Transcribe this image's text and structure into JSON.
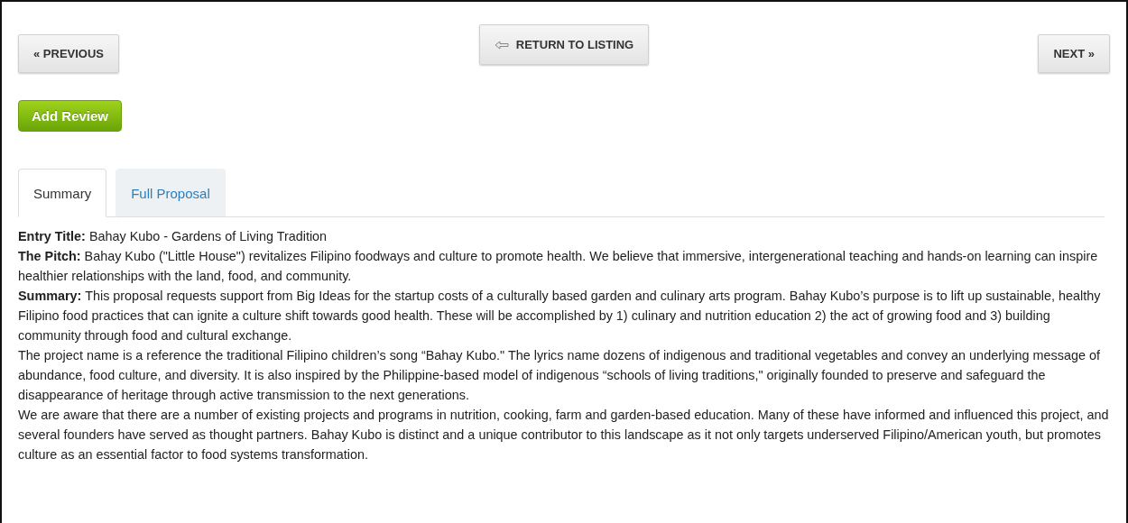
{
  "nav": {
    "previous": "« PREVIOUS",
    "return": "RETURN TO LISTING",
    "next": "NEXT »"
  },
  "add_review": "Add Review",
  "tabs": [
    {
      "label": "Summary",
      "selected": true
    },
    {
      "label": "Full Proposal",
      "selected": false
    }
  ],
  "content": [
    {
      "label": "Entry Title:",
      "text": "Bahay Kubo - Gardens of Living Tradition"
    },
    {
      "label": "The Pitch:",
      "text": "Bahay Kubo (\"Little House\") revitalizes Filipino foodways and culture to promote health. We believe that immersive, intergenerational teaching and hands-on learning can inspire healthier relationships with the land, food, and community."
    },
    {
      "label": "Summary:",
      "text": "This proposal requests support from Big Ideas for the startup costs of a culturally based garden and culinary arts program. Bahay Kubo’s purpose is to lift up sustainable, healthy Filipino food practices that can ignite a culture shift towards good health. These will be accomplished by 1) culinary and nutrition education 2) the act of growing food and 3) building community through food and cultural exchange."
    },
    {
      "text": "The project name is a reference the traditional Filipino children’s song “Bahay Kubo.\" The lyrics name dozens of indigenous and traditional vegetables and convey an underlying message of abundance, food culture, and diversity. It is also inspired by the Philippine-based model of indigenous “schools of living traditions,\" originally founded to preserve and safeguard the disappearance of heritage through active transmission to the next generations."
    },
    {
      "text": "We are aware that there are a number of existing projects and programs in nutrition, cooking, farm and garden-based education. Many of these have informed and influenced this project, and several founders have served as thought partners. Bahay Kubo is distinct and a unique contributor to this landscape as it not only targets underserved Filipino/American youth, but promotes culture as an essential factor to food systems transformation."
    }
  ]
}
